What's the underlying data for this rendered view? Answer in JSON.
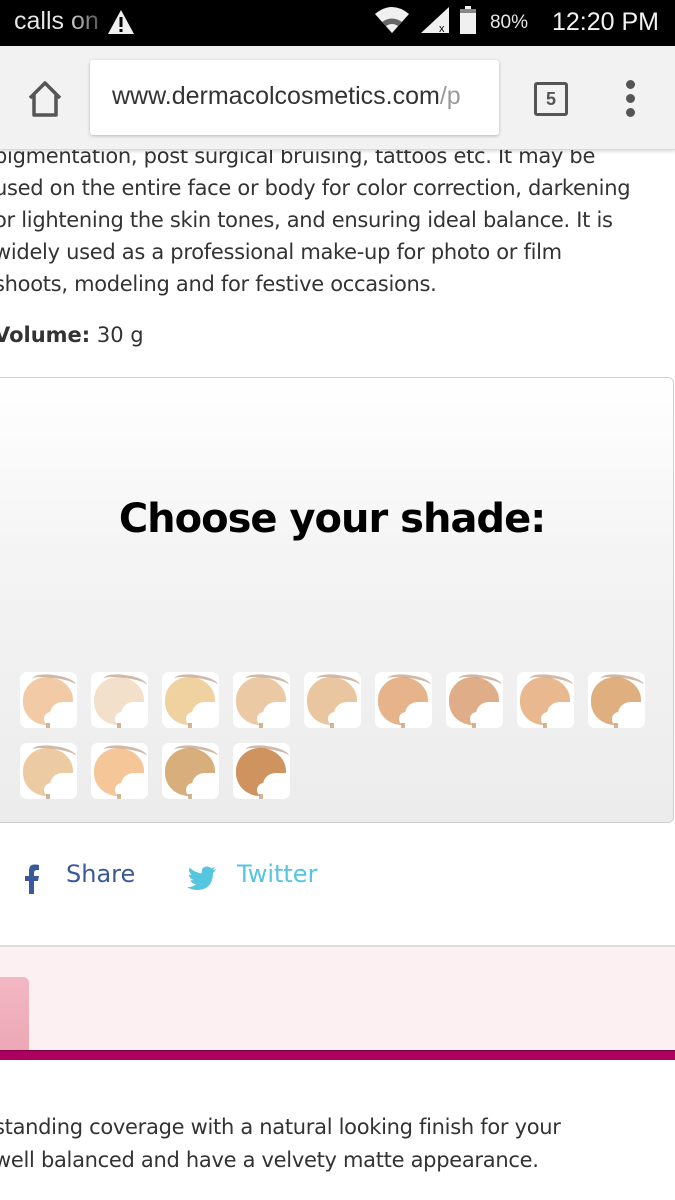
{
  "status_bar": {
    "notification_text": "calls on",
    "warning_icon": "warning-triangle-icon",
    "wifi_icon": "wifi-icon",
    "signal_icon": "signal-no-service-icon",
    "battery_icon": "battery-icon",
    "battery_percent": "80%",
    "time": "12:20 PM"
  },
  "browser": {
    "home_icon": "home-icon",
    "url_host": "www.dermacolcosmetics.com",
    "url_path": "/p",
    "tab_count": "5",
    "menu_icon": "more-vert-icon"
  },
  "content": {
    "description_lines": [
      "pigmentation, post surgical bruising, tattoos etc. It may be",
      "used on the entire face or body for color correction, darkening",
      "or lightening the skin tones, and ensuring ideal balance. It is",
      "widely used as a professional make-up for photo or film",
      "shoots, modeling and for festive occasions."
    ],
    "volume_label": "Volume:",
    "volume_value": "30 g"
  },
  "shade_picker": {
    "title": "Choose your shade:",
    "swatches": [
      {
        "color": "#f2cba6"
      },
      {
        "color": "#f3e0cb"
      },
      {
        "color": "#f0d1a0"
      },
      {
        "color": "#ebc9a4"
      },
      {
        "color": "#e9c6a0"
      },
      {
        "color": "#e7b38b"
      },
      {
        "color": "#dfae88"
      },
      {
        "color": "#e9b88f"
      },
      {
        "color": "#dfaf80"
      },
      {
        "color": "#eccba3"
      },
      {
        "color": "#f4c698"
      },
      {
        "color": "#d8ae7c"
      },
      {
        "color": "#cf9360"
      }
    ]
  },
  "social": {
    "facebook_label": "Share",
    "facebook_color": "#3b5998",
    "twitter_label": "Twitter",
    "twitter_color": "#55c5e0"
  },
  "accent": {
    "pink_band": "#fcf0f2",
    "pink_tab": "#efaebc",
    "magenta_bar": "#ab0062"
  },
  "bottom_text_lines": [
    "standing coverage with a natural looking finish for your",
    "well balanced and have a velvety matte appearance."
  ]
}
